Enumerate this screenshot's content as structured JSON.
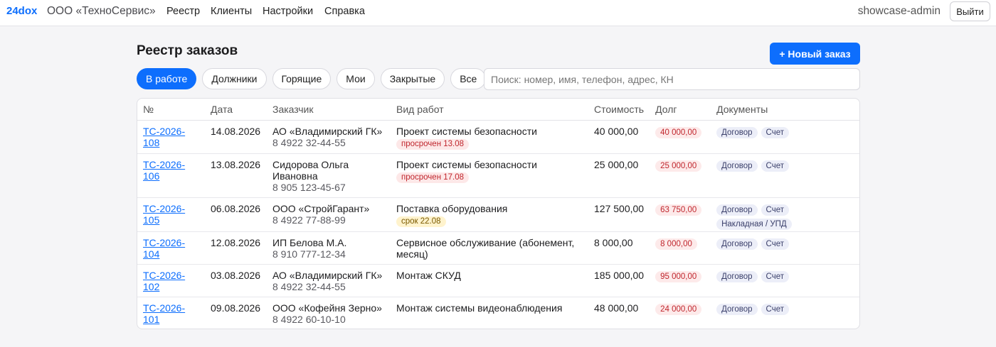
{
  "nav": {
    "brand": "24dox",
    "org": "ООО «ТехноСервис»",
    "links": [
      "Реестр",
      "Клиенты",
      "Настройки",
      "Справка"
    ],
    "user": "showcase-admin",
    "logout": "Выйти"
  },
  "page": {
    "title": "Реестр заказов",
    "new_order": "+ Новый заказ"
  },
  "filters": {
    "chips": [
      "В работе",
      "Должники",
      "Горящие",
      "Мои",
      "Закрытые",
      "Все"
    ],
    "active": "В работе",
    "search_placeholder": "Поиск: номер, имя, телефон, адрес, КН"
  },
  "table": {
    "headers": [
      "№",
      "Дата",
      "Заказчик",
      "Вид работ",
      "Стоимость",
      "Долг",
      "Документы"
    ],
    "rows": [
      {
        "num_a": "ТС-2026-",
        "num_b": "108",
        "date": "14.08.2026",
        "client": "АО «Владимирский ГК»",
        "phone": "8 4922 32-44-55",
        "work": "Проект системы безопасности",
        "status": "просрочен 13.08",
        "status_type": "overdue",
        "cost": "40 000,00",
        "debt": "40 000,00",
        "docs": [
          "Договор",
          "Счет"
        ]
      },
      {
        "num_a": "ТС-2026-",
        "num_b": "106",
        "date": "13.08.2026",
        "client": "Сидорова Ольга Ивановна",
        "phone": "8 905 123-45-67",
        "work": "Проект системы безопасности",
        "status": "просрочен 17.08",
        "status_type": "overdue",
        "cost": "25 000,00",
        "debt": "25 000,00",
        "docs": [
          "Договор",
          "Счет"
        ]
      },
      {
        "num_a": "ТС-2026-",
        "num_b": "105",
        "date": "06.08.2026",
        "client": "ООО «СтройГарант»",
        "phone": "8 4922 77-88-99",
        "work": "Поставка оборудования",
        "status": "срок 22.08",
        "status_type": "due",
        "cost": "127 500,00",
        "debt": "63 750,00",
        "docs": [
          "Договор",
          "Счет",
          "Накладная / УПД"
        ]
      },
      {
        "num_a": "ТС-2026-",
        "num_b": "104",
        "date": "12.08.2026",
        "client": "ИП Белова М.А.",
        "phone": "8 910 777-12-34",
        "work": "Сервисное обслуживание (абонемент, месяц)",
        "status": "",
        "status_type": "",
        "cost": "8 000,00",
        "debt": "8 000,00",
        "docs": [
          "Договор",
          "Счет"
        ]
      },
      {
        "num_a": "ТС-2026-",
        "num_b": "102",
        "date": "03.08.2026",
        "client": "АО «Владимирский ГК»",
        "phone": "8 4922 32-44-55",
        "work": "Монтаж СКУД",
        "status": "",
        "status_type": "",
        "cost": "185 000,00",
        "debt": "95 000,00",
        "docs": [
          "Договор",
          "Счет"
        ]
      },
      {
        "num_a": "ТС-2026-",
        "num_b": "101",
        "date": "09.08.2026",
        "client": "ООО «Кофейня Зерно»",
        "phone": "8 4922 60-10-10",
        "work": "Монтаж системы видеонаблюдения",
        "status": "",
        "status_type": "",
        "cost": "48 000,00",
        "debt": "24 000,00",
        "docs": [
          "Договор",
          "Счет"
        ]
      }
    ]
  },
  "colors": {
    "accent": "#0d6efd",
    "debt": "#c0262d",
    "overdue_bg": "#fde8e8",
    "due_bg": "#fff3cd"
  }
}
